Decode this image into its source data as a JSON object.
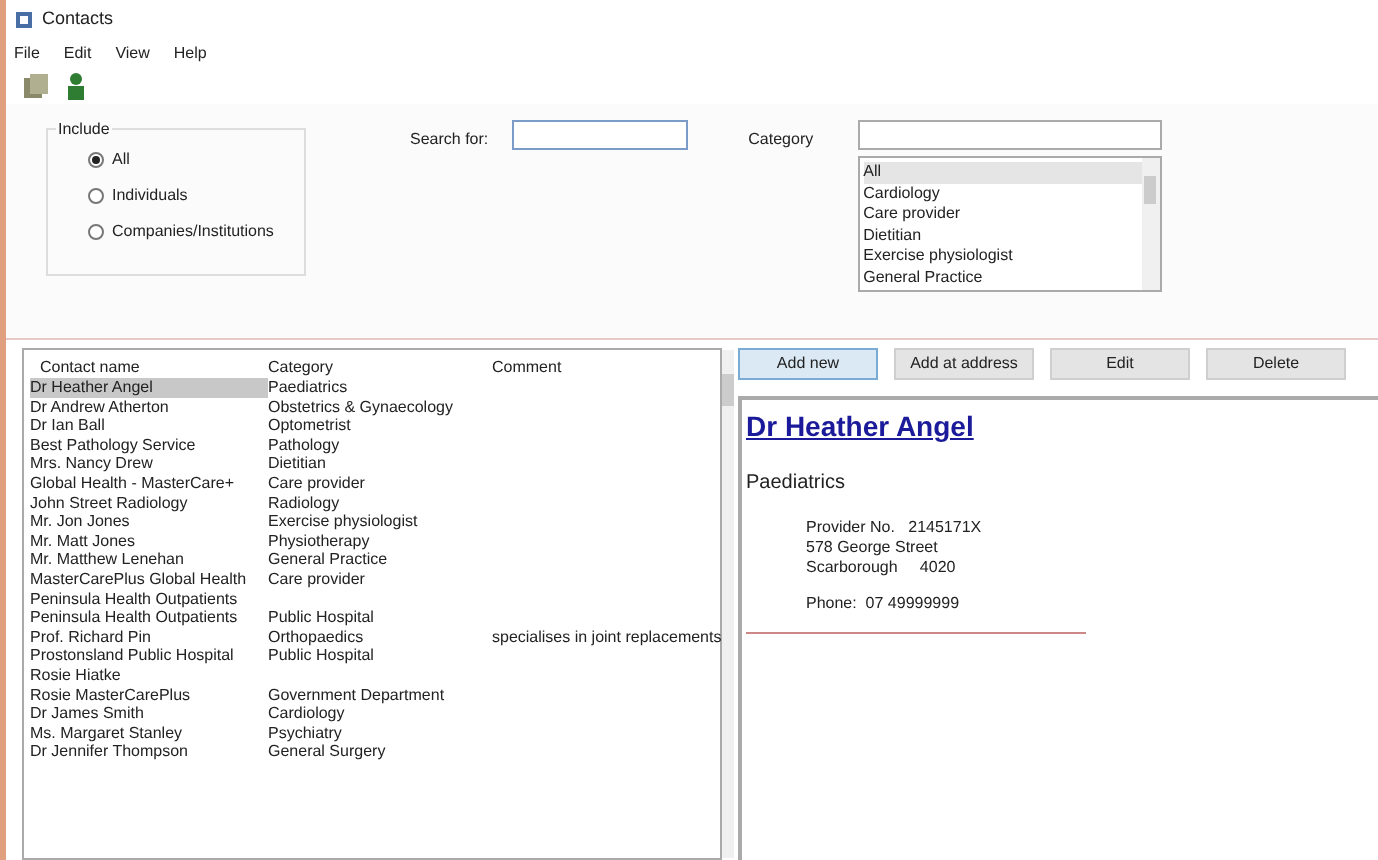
{
  "window": {
    "title": "Contacts"
  },
  "menu": [
    "File",
    "Edit",
    "View",
    "Help"
  ],
  "include": {
    "label": "Include",
    "options": [
      {
        "label": "All",
        "selected": true
      },
      {
        "label": "Individuals",
        "selected": false
      },
      {
        "label": "Companies/Institutions",
        "selected": false
      }
    ]
  },
  "search": {
    "label": "Search for:"
  },
  "category": {
    "label": "Category",
    "items": [
      {
        "label": "All",
        "selected": true
      },
      {
        "label": "Cardiology",
        "selected": false
      },
      {
        "label": "Care provider",
        "selected": false
      },
      {
        "label": "Dietitian",
        "selected": false
      },
      {
        "label": "Exercise physiologist",
        "selected": false
      },
      {
        "label": "General Practice",
        "selected": false
      }
    ]
  },
  "table": {
    "columns": [
      "Contact name",
      "Category",
      "Comment"
    ],
    "rows": [
      {
        "name": "Dr Heather Angel",
        "category": "Paediatrics",
        "selected": true
      },
      {
        "name": "Dr Andrew Atherton",
        "category": "Obstetrics & Gynaecology",
        "selected": false
      },
      {
        "name": "Dr Ian Ball",
        "category": "Optometrist",
        "selected": false
      },
      {
        "name": "Best Pathology Service",
        "category": "Pathology",
        "selected": false
      },
      {
        "name": "Mrs. Nancy Drew",
        "category": "Dietitian",
        "selected": false
      },
      {
        "name": "Global Health - MasterCare+",
        "category": "Care provider",
        "selected": false
      },
      {
        "name": "John Street Radiology",
        "category": "Radiology",
        "selected": false
      },
      {
        "name": "Mr. Jon Jones",
        "category": "Exercise physiologist",
        "selected": false
      },
      {
        "name": "Mr. Matt Jones",
        "category": "Physiotherapy",
        "selected": false
      },
      {
        "name": "Mr. Matthew Lenehan",
        "category": "General Practice",
        "selected": false
      },
      {
        "name": "MasterCarePlus Global Health",
        "category": "Care provider",
        "selected": false
      },
      {
        "name": "Peninsula Health Outpatients",
        "selected": false
      },
      {
        "name": "Peninsula Health Outpatients",
        "category": "Public Hospital",
        "selected": false
      },
      {
        "name": "Prof. Richard Pin",
        "category": "Orthopaedics",
        "comment": "specialises in joint replacements",
        "selected": false
      },
      {
        "name": "Prostonsland Public Hospital",
        "category": "Public Hospital",
        "selected": false
      },
      {
        "name": "Rosie Hiatke",
        "selected": false
      },
      {
        "name": "Rosie MasterCarePlus",
        "category": "Government Department",
        "selected": false
      },
      {
        "name": "Dr James Smith",
        "category": "Cardiology",
        "selected": false
      },
      {
        "name": "Ms. Margaret Stanley",
        "category": "Psychiatry",
        "selected": false
      },
      {
        "name": "Dr Jennifer Thompson",
        "category": "General Surgery",
        "selected": false
      }
    ]
  },
  "buttons": [
    {
      "label": "Add new",
      "selected": true
    },
    {
      "label": "Add at address",
      "selected": false
    },
    {
      "label": "Edit",
      "selected": false
    },
    {
      "label": "Delete",
      "selected": false
    }
  ],
  "detail": {
    "name": "Dr Heather Angel",
    "category": "Paediatrics",
    "lines": [
      "Provider No.   2145171X",
      "578 George Street",
      "Scarborough     4020"
    ],
    "phone": "Phone:  07 49999999"
  }
}
